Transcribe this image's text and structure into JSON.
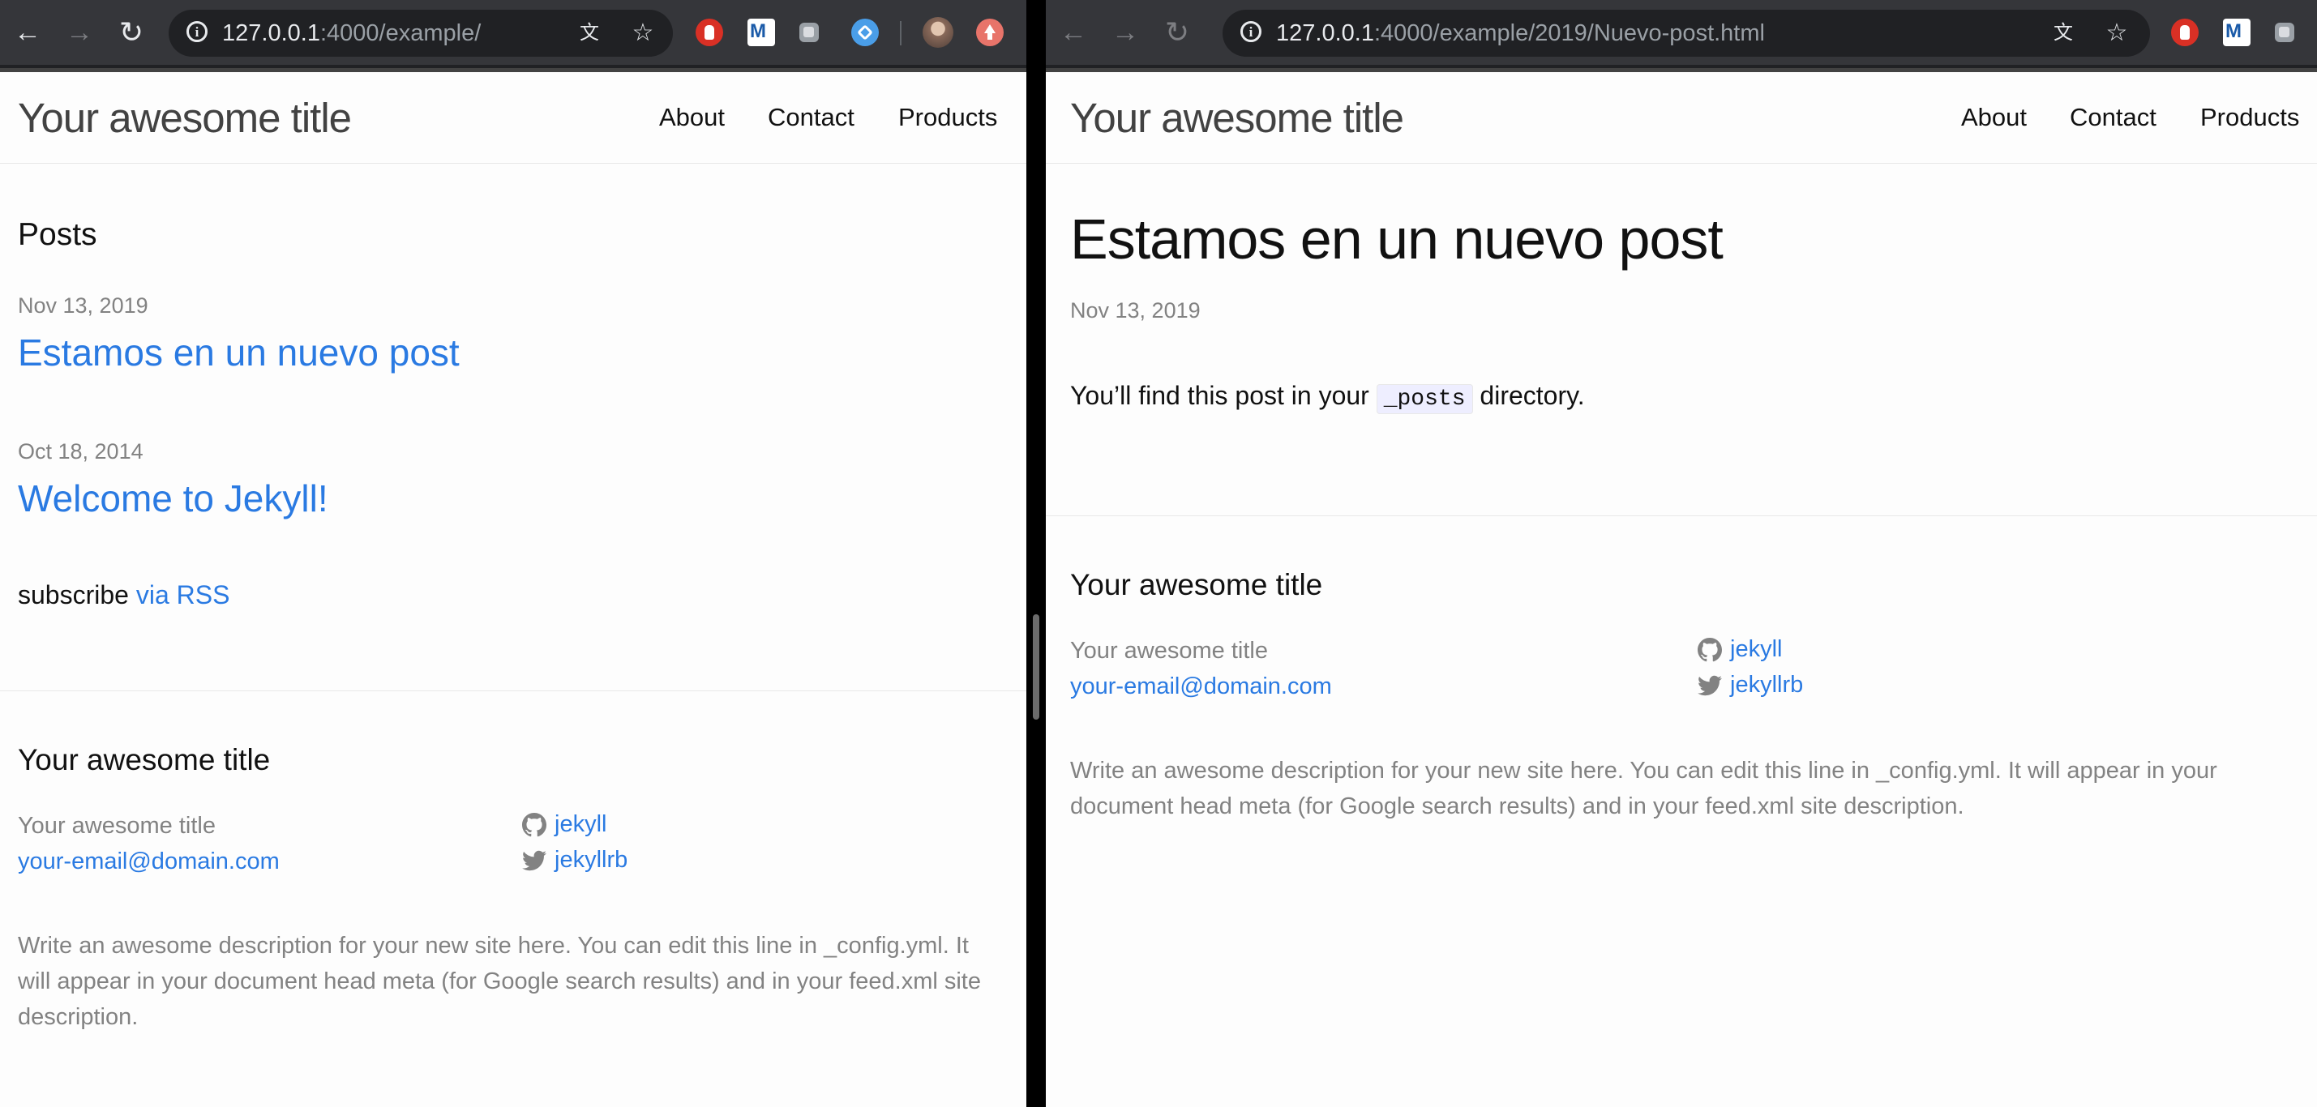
{
  "left": {
    "url_host": "127.0.0.1",
    "url_rest": ":4000/example/",
    "site_title": "Your awesome title",
    "nav": [
      "About",
      "Contact",
      "Products"
    ],
    "posts_heading": "Posts",
    "posts": [
      {
        "date": "Nov 13, 2019",
        "title": "Estamos en un nuevo post"
      },
      {
        "date": "Oct 18, 2014",
        "title": "Welcome to Jekyll!"
      }
    ],
    "subscribe_text": "subscribe",
    "rss_link": "via RSS",
    "footer": {
      "heading": "Your awesome title",
      "name": "Your awesome title",
      "email": "your-email@domain.com",
      "github": "jekyll",
      "twitter": "jekyllrb",
      "description": "Write an awesome description for your new site here. You can edit this line in _config.yml. It will appear in your document head meta (for Google search results) and in your feed.xml site description."
    }
  },
  "right": {
    "url_host": "127.0.0.1",
    "url_rest": ":4000/example/2019/Nuevo-post.html",
    "site_title": "Your awesome title",
    "nav": [
      "About",
      "Contact",
      "Products"
    ],
    "post_title": "Estamos en un nuevo post",
    "post_date": "Nov 13, 2019",
    "body_before": "You’ll find this post in your",
    "body_code": "_posts",
    "body_after": "directory.",
    "footer": {
      "heading": "Your awesome title",
      "name": "Your awesome title",
      "email": "your-email@domain.com",
      "github": "jekyll",
      "twitter": "jekyllrb",
      "description": "Write an awesome description for your new site here. You can edit this line in _config.yml. It will appear in your document head meta (for Google search results) and in your feed.xml site description."
    }
  },
  "icons": [
    "back-arrow-icon",
    "forward-arrow-icon",
    "reload-icon",
    "info-icon",
    "translate-icon",
    "star-icon",
    "github-icon",
    "twitter-icon"
  ],
  "colors": {
    "link": "#2a7ae2",
    "meta": "#828282",
    "header_border": "#424242",
    "toolbar": "#35363a"
  }
}
